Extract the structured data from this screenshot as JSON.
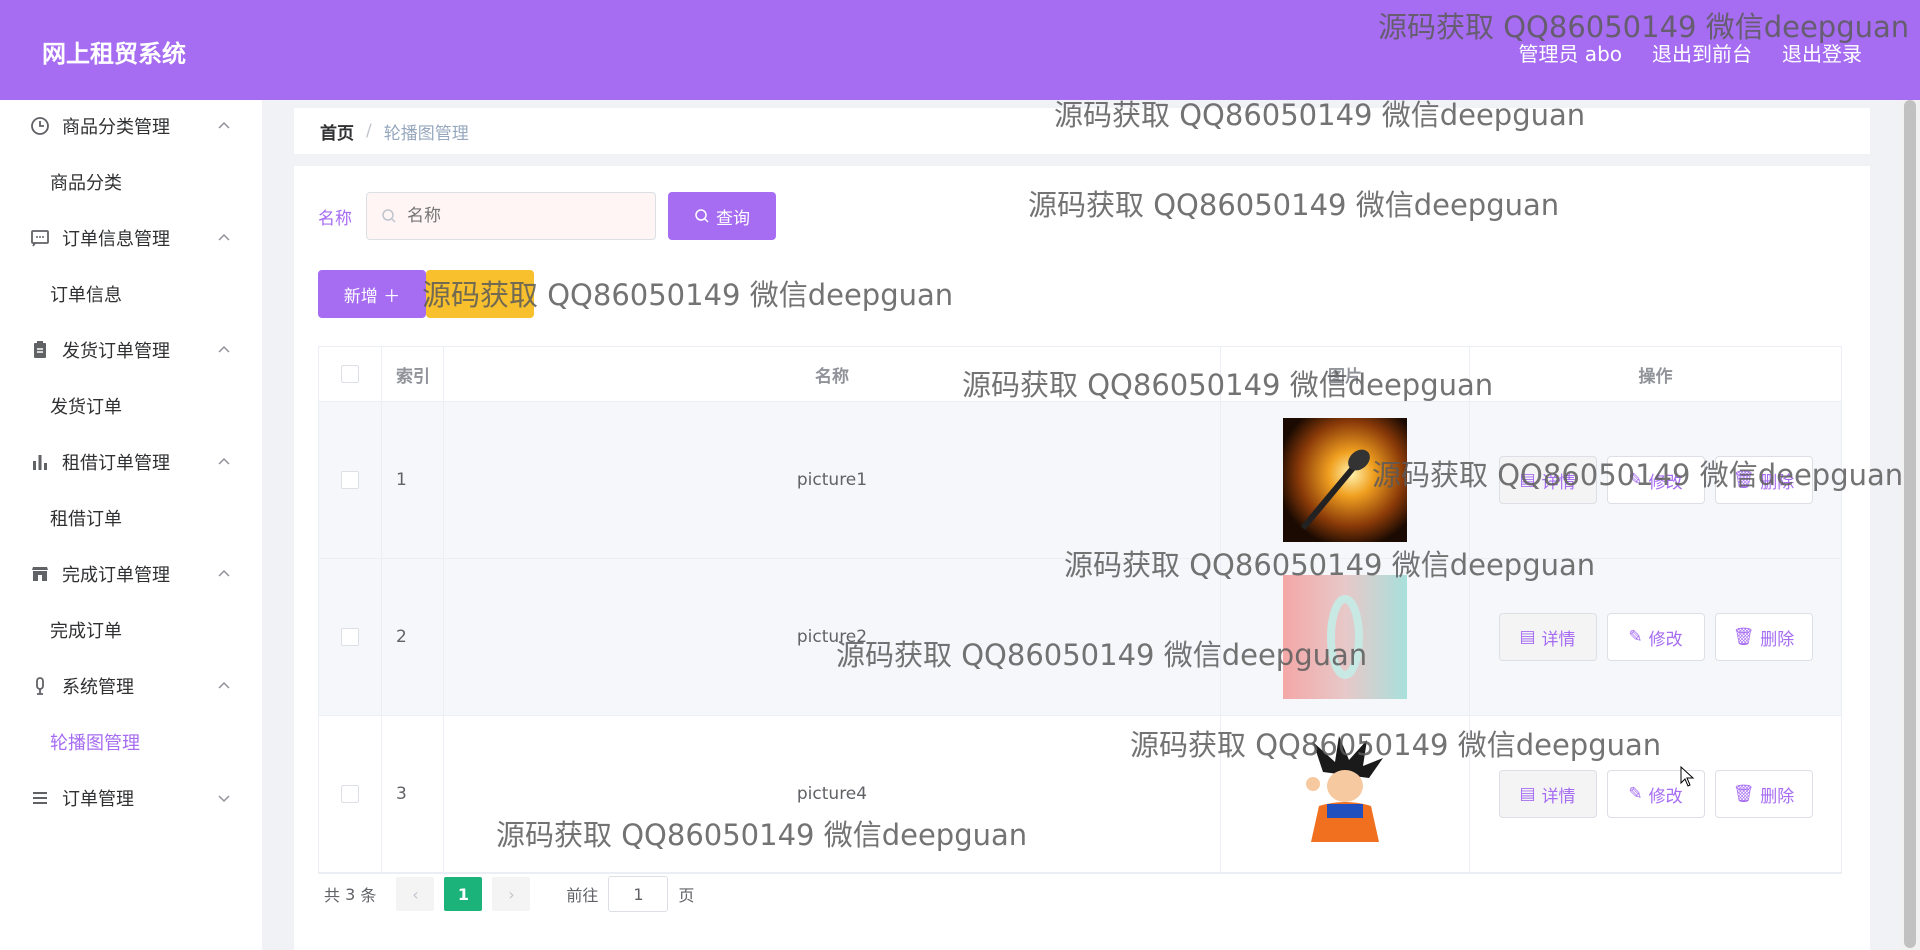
{
  "header": {
    "brand": "网上租贸系统",
    "user_label": "管理员 abo",
    "to_front": "退出到前台",
    "logout": "退出登录"
  },
  "sidebar": {
    "groups": [
      {
        "title": "商品分类管理",
        "icon": "clock-icon",
        "expanded": true,
        "items": [
          "商品分类"
        ]
      },
      {
        "title": "订单信息管理",
        "icon": "chat-icon",
        "expanded": true,
        "items": [
          "订单信息"
        ]
      },
      {
        "title": "发货订单管理",
        "icon": "clipboard-icon",
        "expanded": true,
        "items": [
          "发货订单"
        ]
      },
      {
        "title": "租借订单管理",
        "icon": "bar-chart-icon",
        "expanded": true,
        "items": [
          "租借订单"
        ]
      },
      {
        "title": "完成订单管理",
        "icon": "shop-icon",
        "expanded": true,
        "items": [
          "完成订单"
        ]
      },
      {
        "title": "系统管理",
        "icon": "microphone-icon",
        "expanded": true,
        "items": [
          "轮播图管理"
        ]
      },
      {
        "title": "订单管理",
        "icon": "list-icon",
        "expanded": false,
        "items": []
      }
    ],
    "active_item": "轮播图管理"
  },
  "breadcrumb": {
    "home": "首页",
    "sep": "/",
    "current": "轮播图管理"
  },
  "search": {
    "label": "名称",
    "placeholder": "名称",
    "query_button": "查询"
  },
  "actions": {
    "add_button": "新增 ＋"
  },
  "table": {
    "columns": [
      "索引",
      "名称",
      "图片",
      "操作"
    ],
    "rows": [
      {
        "index": "1",
        "name": "picture1",
        "image": "microphone-photo"
      },
      {
        "index": "2",
        "name": "picture2",
        "image": "pastel-abstract-photo"
      },
      {
        "index": "3",
        "name": "picture4",
        "image": "cartoon-character-photo"
      }
    ],
    "op_detail": "详情",
    "op_edit": "修改",
    "op_delete": "删除"
  },
  "pagination": {
    "total_prefix": "共",
    "total": "3",
    "total_suffix": "条",
    "current_page": "1",
    "goto_label": "前往",
    "goto_value": "1",
    "page_suffix": "页"
  },
  "watermark": "源码获取 QQ86050149 微信deepguan",
  "colors": {
    "primary": "#a66cf2",
    "pager_active": "#1bb37a",
    "delete_button": "#f7c02c"
  }
}
